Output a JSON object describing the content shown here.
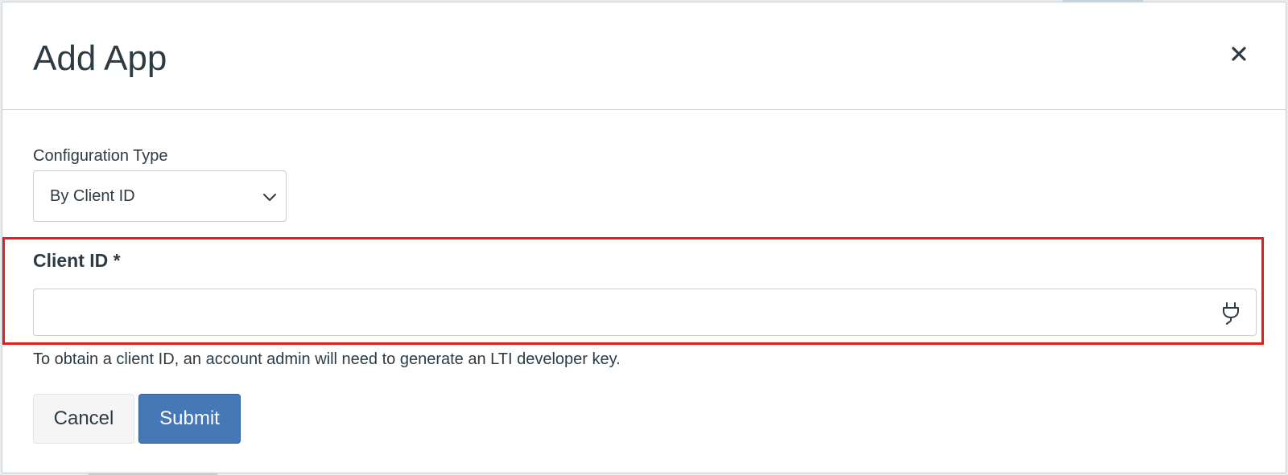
{
  "modal": {
    "title": "Add App",
    "close_icon": "close-icon"
  },
  "config_type": {
    "label": "Configuration Type",
    "selected": "By Client ID",
    "chevron_icon": "chevron-down-icon"
  },
  "client_id": {
    "label": "Client ID *",
    "value": "",
    "placeholder": "",
    "icon": "plug-icon"
  },
  "help_text": "To obtain a client ID, an account admin will need to generate an LTI developer key.",
  "buttons": {
    "cancel_label": "Cancel",
    "submit_label": "Submit"
  },
  "colors": {
    "primary": "#4678b8",
    "highlight": "#e0201c",
    "text": "#2d3b45"
  }
}
